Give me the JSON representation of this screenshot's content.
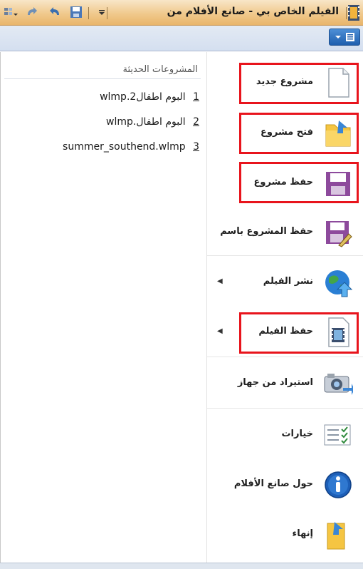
{
  "window": {
    "title": "الفيلم الخاص بي - صانع الأفلام من"
  },
  "recent": {
    "header": "المشروعات الحديثة",
    "items": [
      {
        "num": "1",
        "name": "البوم اطفال2.wlmp"
      },
      {
        "num": "2",
        "name": "البوم اطفال.wlmp"
      },
      {
        "num": "3",
        "name": "summer_southend.wlmp"
      }
    ]
  },
  "menu": {
    "new_project": "مشروع جديد",
    "open_project": "فتح مشروع",
    "save_project": "حفظ مشروع",
    "save_project_as": "حفظ المشروع باسم",
    "publish_movie": "نشر الفيلم",
    "save_movie": "حفظ الفيلم",
    "import_device": "استيراد من جهاز",
    "options": "خيارات",
    "about": "حول صانع الأفلام",
    "exit": "إنهاء"
  },
  "colors": {
    "highlight": "#e8141c",
    "titlebar": "#f0c98c",
    "accent": "#1f5fae"
  }
}
